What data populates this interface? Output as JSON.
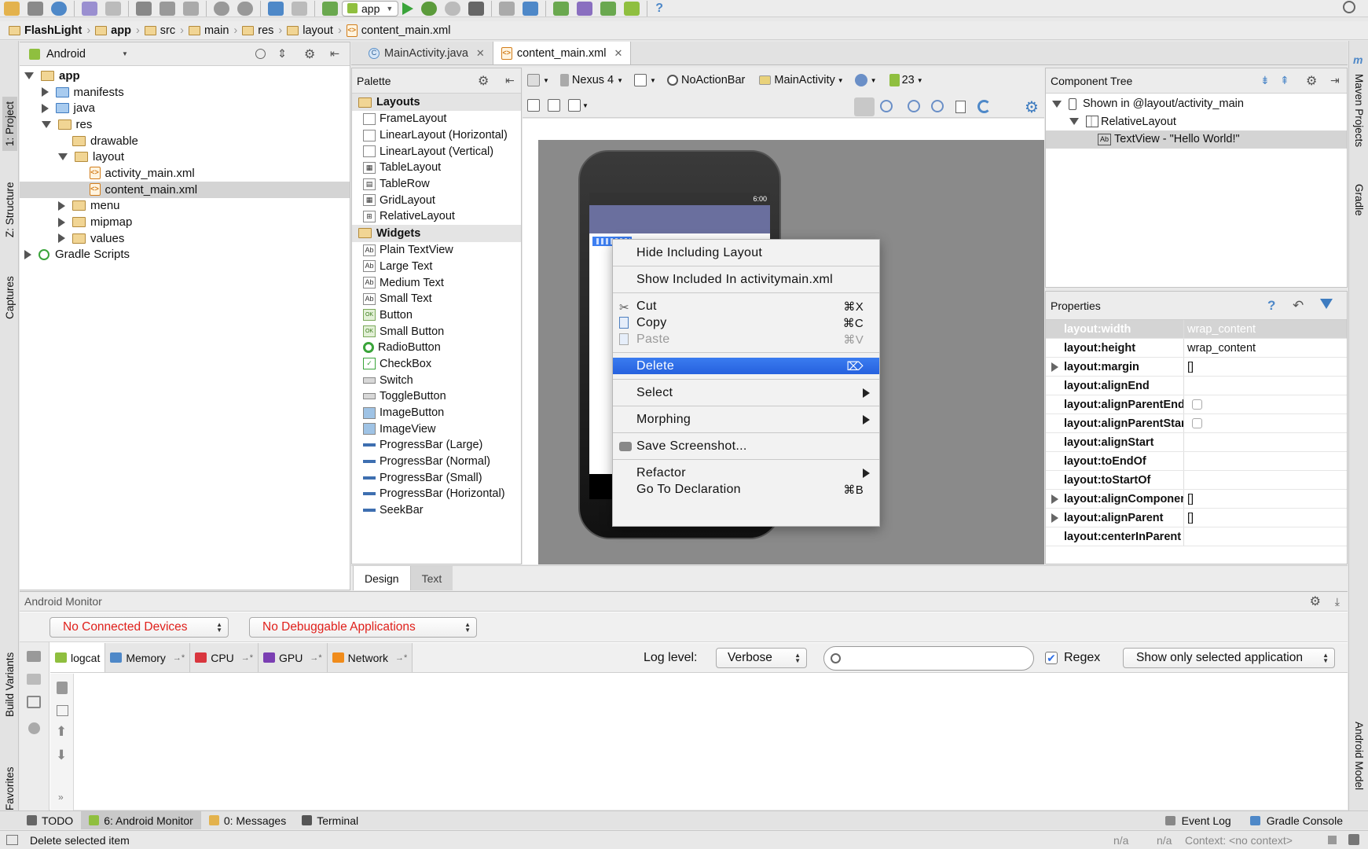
{
  "toolbar": {
    "run_config": "app",
    "icons": [
      "open-icon",
      "save-icon",
      "sync-icon",
      "undo-icon",
      "redo-icon",
      "cut-icon",
      "copy-icon",
      "paste-icon",
      "find-icon",
      "replace-icon",
      "back-icon",
      "forward-icon",
      "make-icon",
      "run-icon",
      "debug-icon",
      "attach-debugger-icon",
      "android-device-monitor-icon",
      "project-structure-icon",
      "sdk-manager-icon",
      "avd-manager-icon",
      "help-icon"
    ]
  },
  "breadcrumb": [
    "FlashLight",
    "app",
    "src",
    "main",
    "res",
    "layout",
    "content_main.xml"
  ],
  "project": {
    "view_mode": "Android",
    "tree": [
      {
        "label": "app",
        "level": 0,
        "type": "module",
        "expanded": true,
        "bold": true
      },
      {
        "label": "manifests",
        "level": 1,
        "type": "folder-blue",
        "expanded": false
      },
      {
        "label": "java",
        "level": 1,
        "type": "folder-blue",
        "expanded": false
      },
      {
        "label": "res",
        "level": 1,
        "type": "folder-res",
        "expanded": true
      },
      {
        "label": "drawable",
        "level": 2,
        "type": "folder",
        "leaf": true
      },
      {
        "label": "layout",
        "level": 2,
        "type": "folder",
        "expanded": true
      },
      {
        "label": "activity_main.xml",
        "level": 3,
        "type": "xml",
        "leaf": true
      },
      {
        "label": "content_main.xml",
        "level": 3,
        "type": "xml",
        "leaf": true,
        "selected": true
      },
      {
        "label": "menu",
        "level": 2,
        "type": "folder",
        "expanded": false
      },
      {
        "label": "mipmap",
        "level": 2,
        "type": "folder",
        "expanded": false
      },
      {
        "label": "values",
        "level": 2,
        "type": "folder",
        "expanded": false
      },
      {
        "label": "Gradle Scripts",
        "level": 0,
        "type": "gradle",
        "expanded": false
      }
    ]
  },
  "left_tool_tabs": [
    "1: Project",
    "Z: Structure",
    "Captures",
    "Build Variants",
    "2: Favorites"
  ],
  "right_tool_tabs": [
    "Maven Projects",
    "Gradle",
    "Android Model"
  ],
  "editor_tabs": [
    {
      "label": "MainActivity.java",
      "active": false
    },
    {
      "label": "content_main.xml",
      "active": true
    }
  ],
  "palette": {
    "title": "Palette",
    "groups": [
      {
        "name": "Layouts",
        "items": [
          "FrameLayout",
          "LinearLayout (Horizontal)",
          "LinearLayout (Vertical)",
          "TableLayout",
          "TableRow",
          "GridLayout",
          "RelativeLayout"
        ]
      },
      {
        "name": "Widgets",
        "items": [
          "Plain TextView",
          "Large Text",
          "Medium Text",
          "Small Text",
          "Button",
          "Small Button",
          "RadioButton",
          "CheckBox",
          "Switch",
          "ToggleButton",
          "ImageButton",
          "ImageView",
          "ProgressBar (Large)",
          "ProgressBar (Normal)",
          "ProgressBar (Small)",
          "ProgressBar (Horizontal)",
          "SeekBar"
        ]
      }
    ]
  },
  "designer": {
    "device": "Nexus 4",
    "theme": "NoActionBar",
    "activity": "MainActivity",
    "api": "23",
    "phone_time": "6:00",
    "bottom_tabs": [
      {
        "label": "Design",
        "active": true
      },
      {
        "label": "Text",
        "active": false
      }
    ]
  },
  "context_menu": {
    "items": [
      {
        "label": "Hide Including Layout"
      },
      {
        "sep": true
      },
      {
        "label": "Show Included In activitymain.xml"
      },
      {
        "sep": true
      },
      {
        "label": "Cut",
        "shortcut": "⌘X",
        "icon": "cut-icon"
      },
      {
        "label": "Copy",
        "shortcut": "⌘C",
        "icon": "copy-icon"
      },
      {
        "label": "Paste",
        "shortcut": "⌘V",
        "icon": "paste-icon",
        "disabled": true
      },
      {
        "sep": true
      },
      {
        "label": "Delete",
        "shortcut": "⌦",
        "highlighted": true
      },
      {
        "sep": true
      },
      {
        "label": "Select",
        "submenu": true
      },
      {
        "sep": true
      },
      {
        "label": "Morphing",
        "submenu": true
      },
      {
        "sep": true
      },
      {
        "label": "Save Screenshot...",
        "icon": "camera-icon"
      },
      {
        "sep": true
      },
      {
        "label": "Refactor",
        "submenu": true
      },
      {
        "label": "Go To Declaration",
        "shortcut": "⌘B"
      }
    ]
  },
  "component_tree": {
    "title": "Component Tree",
    "nodes": [
      {
        "label": "Shown in @layout/activity_main",
        "level": 0
      },
      {
        "label": "RelativeLayout",
        "level": 1
      },
      {
        "label": "TextView - \"Hello World!\"",
        "level": 2,
        "selected": true
      }
    ]
  },
  "properties": {
    "title": "Properties",
    "rows": [
      {
        "name": "layout:width",
        "value": "wrap_content",
        "selected": true
      },
      {
        "name": "layout:height",
        "value": "wrap_content"
      },
      {
        "name": "layout:margin",
        "value": "[]",
        "expandable": true
      },
      {
        "name": "layout:alignEnd",
        "value": ""
      },
      {
        "name": "layout:alignParentEnd",
        "value": "",
        "checkbox": true
      },
      {
        "name": "layout:alignParentStart",
        "value": "",
        "checkbox": true
      },
      {
        "name": "layout:alignStart",
        "value": ""
      },
      {
        "name": "layout:toEndOf",
        "value": ""
      },
      {
        "name": "layout:toStartOf",
        "value": ""
      },
      {
        "name": "layout:alignComponent",
        "value": "[]",
        "expandable": true
      },
      {
        "name": "layout:alignParent",
        "value": "[]",
        "expandable": true
      },
      {
        "name": "layout:centerInParent",
        "value": ""
      }
    ]
  },
  "monitor": {
    "title": "Android Monitor",
    "devices": "No Connected Devices",
    "apps": "No Debuggable Applications",
    "tabs": [
      {
        "label": "logcat",
        "active": true
      },
      {
        "label": "Memory"
      },
      {
        "label": "CPU"
      },
      {
        "label": "GPU"
      },
      {
        "label": "Network"
      }
    ],
    "log_level_label": "Log level:",
    "log_level": "Verbose",
    "search_placeholder": "",
    "regex_label": "Regex",
    "regex_checked": true,
    "filter": "Show only selected application"
  },
  "bottom_tools": [
    {
      "label": "TODO"
    },
    {
      "label": "6: Android Monitor",
      "active": true
    },
    {
      "label": "0: Messages"
    },
    {
      "label": "Terminal"
    }
  ],
  "bottom_tools_right": [
    {
      "label": "Event Log"
    },
    {
      "label": "Gradle Console"
    }
  ],
  "status": {
    "message": "Delete selected item",
    "pos1": "n/a",
    "pos2": "n/a",
    "context": "Context: <no context>"
  },
  "colors": {
    "selection": "#2f6fe6",
    "accent_red": "#e0201b",
    "chrome": "#e8e8e8"
  }
}
